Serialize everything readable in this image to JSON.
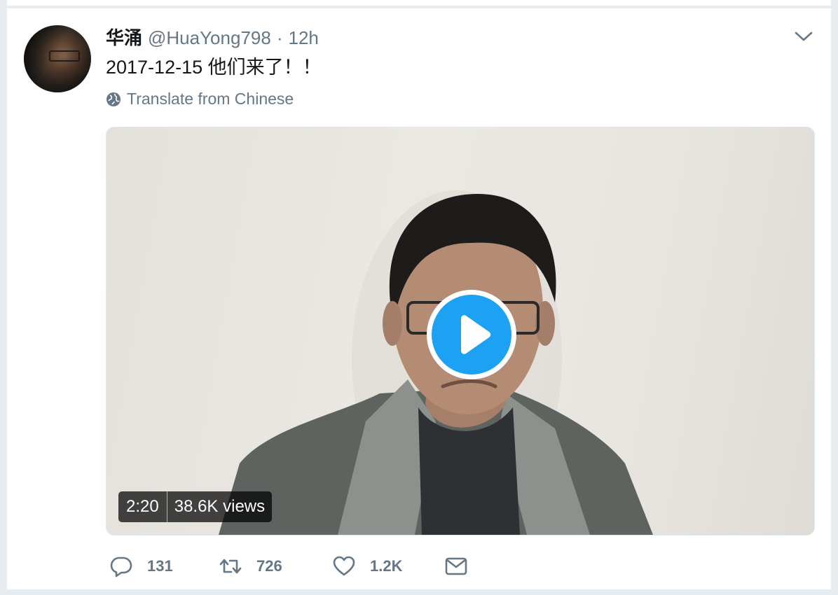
{
  "tweet": {
    "author_name": "华涌",
    "handle": "@HuaYong798",
    "separator": "·",
    "time": "12h",
    "text": "2017-12-15 他们来了！！",
    "translate_label": "Translate from Chinese"
  },
  "video": {
    "duration": "2:20",
    "views": "38.6K views"
  },
  "actions": {
    "reply_count": "131",
    "retweet_count": "726",
    "like_count": "1.2K"
  },
  "icons": {
    "caret": "chevron-down-icon",
    "translate": "globe-icon",
    "play": "play-icon",
    "reply": "reply-icon",
    "retweet": "retweet-icon",
    "like": "heart-icon",
    "message": "envelope-icon"
  },
  "colors": {
    "accent": "#1da1f2",
    "muted": "#657786",
    "text": "#14171a",
    "background": "#e6ecf0"
  }
}
